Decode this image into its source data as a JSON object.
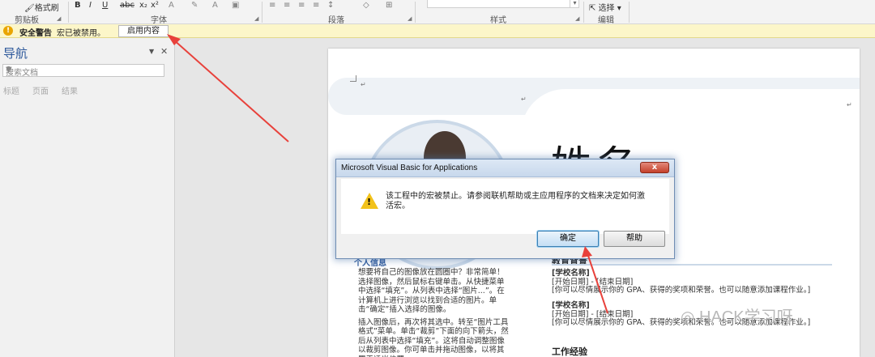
{
  "ribbon": {
    "format_painter": "格式刷",
    "clipboard_group": "剪贴板",
    "font_group": "字体",
    "paragraph_group": "段落",
    "styles_group": "样式",
    "select_btn": "选择",
    "editing_group": "编辑"
  },
  "security_bar": {
    "title": "安全警告",
    "message": "宏已被禁用。",
    "enable_button": "启用内容"
  },
  "nav_pane": {
    "title": "导航",
    "search_placeholder": "搜索文档",
    "tabs": [
      "标题",
      "页面",
      "结果"
    ]
  },
  "document": {
    "name": "姓名",
    "left_heading": "个人信息",
    "left_paragraphs": [
      "想要将自己的图像放在圆圈中？非常简单！选择图像，然后鼠标右键单击。从快捷菜单中选择“填充”。从列表中选择“图片...”。在计算机上进行浏览以找到合适的图片。单击“确定”插入选择的图像。",
      "插入图像后，再次将其选中。转至“图片工具格式”菜单。单击“裁剪”下面的向下箭头，然后从列表中选择“填充”。这将自动调整图像以裁剪图像。你可单击并拖动图像，以将其置于适当位置。"
    ],
    "education_title": "教育背景",
    "education": [
      {
        "school": "[学校名称]",
        "dates": "[开始日期] - [结束日期]",
        "desc": "[你可以尽情展示你的 GPA、获得的奖项和荣誉。也可以随意添加课程作业。]"
      },
      {
        "school": "[学校名称]",
        "dates": "[开始日期] - [结束日期]",
        "desc": "[你可以尽情展示你的 GPA、获得的奖项和荣誉。也可以随意添加课程作业。]"
      }
    ],
    "work_title": "工作经验"
  },
  "dialog": {
    "title": "Microsoft Visual Basic for Applications",
    "close_label": "x",
    "message": "该工程中的宏被禁止。请参阅联机帮助或主应用程序的文档来决定如何激活宏。",
    "ok_label": "确定",
    "help_label": "帮助"
  },
  "watermark": "HACK学习呀",
  "colors": {
    "security_bar_bg": "#fcf6c9",
    "nav_title": "#2b579a",
    "arrow": "#e8413b",
    "dialog_border": "#6f8db3"
  }
}
